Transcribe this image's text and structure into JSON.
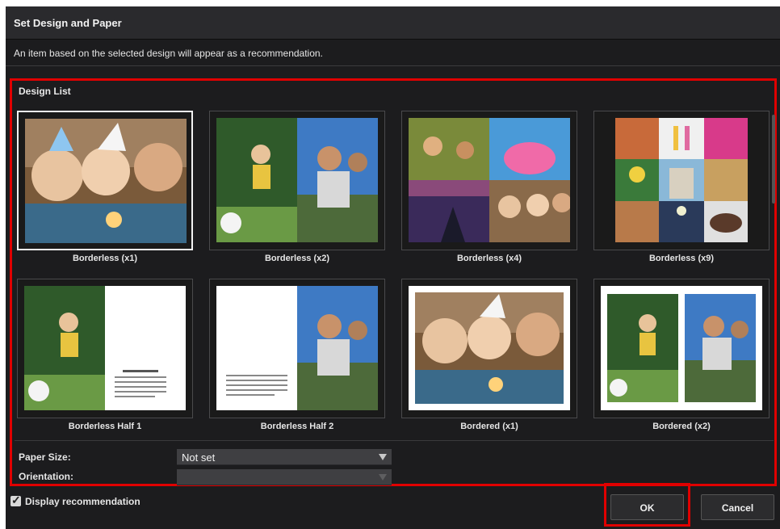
{
  "dialog": {
    "title": "Set Design and Paper",
    "description": "An item based on the selected design will appear as a recommendation.",
    "design_list_label": "Design List"
  },
  "designs": [
    {
      "label": "Borderless (x1)",
      "selected": true
    },
    {
      "label": "Borderless (x2)",
      "selected": false
    },
    {
      "label": "Borderless (x4)",
      "selected": false
    },
    {
      "label": "Borderless (x9)",
      "selected": false
    },
    {
      "label": "Borderless Half 1",
      "selected": false
    },
    {
      "label": "Borderless Half 2",
      "selected": false
    },
    {
      "label": "Bordered (x1)",
      "selected": false
    },
    {
      "label": "Bordered (x2)",
      "selected": false
    }
  ],
  "paper_size": {
    "label": "Paper Size:",
    "value": "Not set"
  },
  "orientation": {
    "label": "Orientation:",
    "value": ""
  },
  "display_recommendation": {
    "label": "Display recommendation",
    "checked": true
  },
  "buttons": {
    "ok": "OK",
    "cancel": "Cancel"
  },
  "colors": {
    "highlight": "#e00000",
    "background": "#1c1c1e"
  }
}
